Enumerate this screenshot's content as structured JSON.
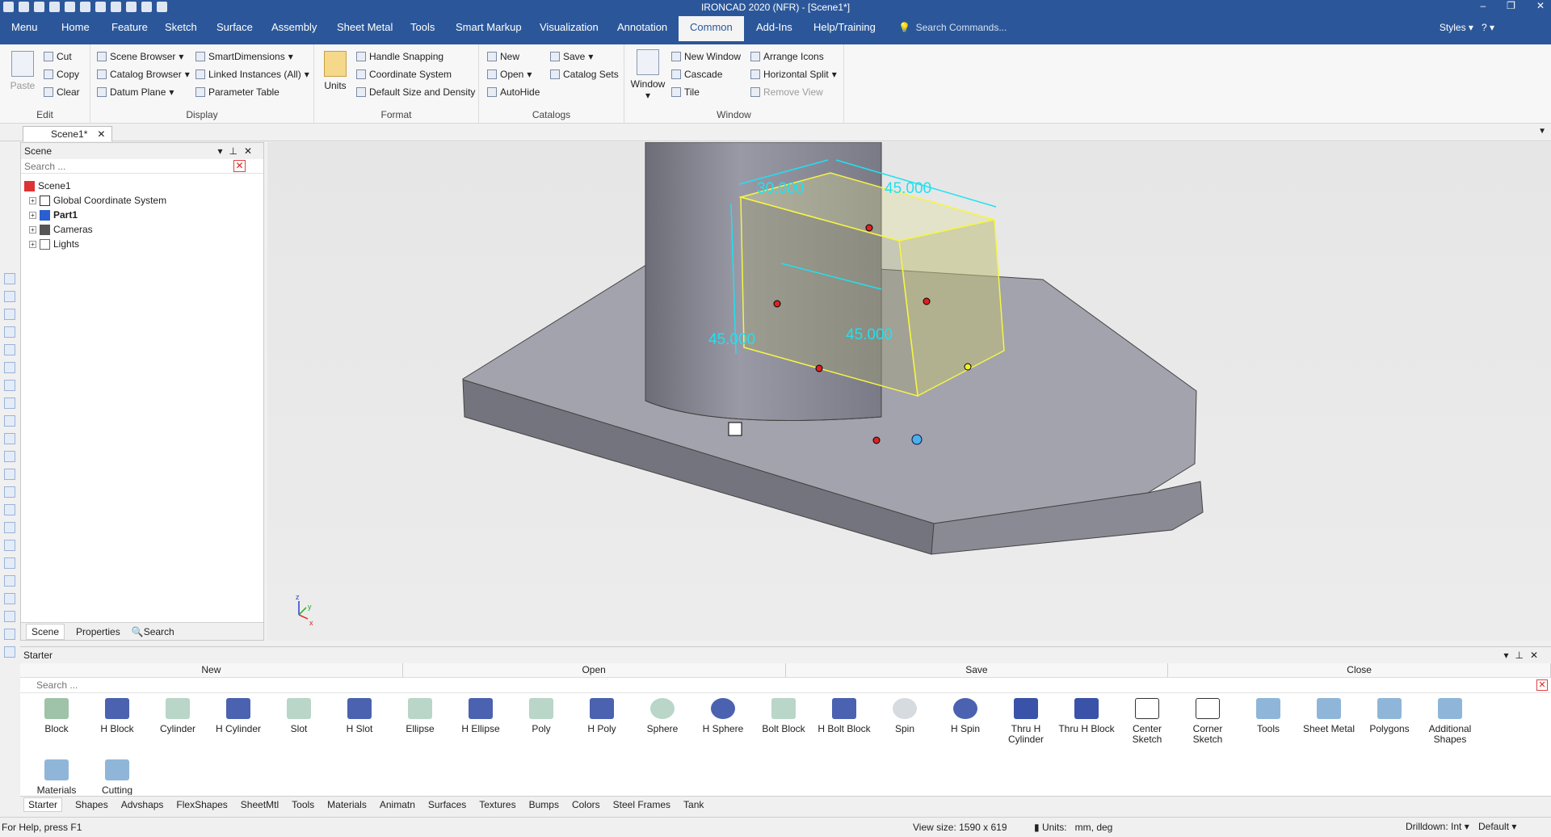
{
  "app": {
    "title": "IRONCAD 2020 (NFR) - [Scene1*]"
  },
  "menu": {
    "tabs": [
      "Menu",
      "Home",
      "Feature",
      "Sketch",
      "Surface",
      "Assembly",
      "Sheet Metal",
      "Tools",
      "Smart Markup",
      "Visualization",
      "Annotation",
      "Common",
      "Add-Ins",
      "Help/Training"
    ],
    "active": "Common",
    "search_placeholder": "Search Commands...",
    "styles": "Styles"
  },
  "ribbon": {
    "edit": {
      "label": "Edit",
      "paste": "Paste",
      "cut": "Cut",
      "copy": "Copy",
      "clear": "Clear"
    },
    "display": {
      "label": "Display",
      "scene_browser": "Scene Browser",
      "catalog_browser": "Catalog Browser",
      "datum_plane": "Datum Plane",
      "smart_dimensions": "SmartDimensions",
      "linked_instances": "Linked Instances (All)",
      "parameter_table": "Parameter Table"
    },
    "format": {
      "label": "Format",
      "units": "Units",
      "handle_snapping": "Handle Snapping",
      "coordinate_system": "Coordinate System",
      "default_size": "Default Size and Density"
    },
    "catalogs": {
      "label": "Catalogs",
      "new": "New",
      "open": "Open",
      "autohide": "AutoHide",
      "save": "Save",
      "catalog_sets": "Catalog Sets"
    },
    "window": {
      "label": "Window",
      "window": "Window",
      "new_window": "New Window",
      "cascade": "Cascade",
      "tile": "Tile",
      "arrange_icons": "Arrange Icons",
      "horizontal_split": "Horizontal Split",
      "remove_view": "Remove View"
    }
  },
  "doc_tab": "Scene1*",
  "scene_panel": {
    "title": "Scene",
    "search_placeholder": "Search ...",
    "tree": [
      "Scene1",
      "Global Coordinate System",
      "Part1",
      "Cameras",
      "Lights"
    ],
    "tabs": [
      "Scene",
      "Properties",
      "Search"
    ]
  },
  "viewport": {
    "dims": [
      "30.000",
      "45.000",
      "45.000",
      "45.000"
    ],
    "axes": [
      "z",
      "y",
      "x"
    ]
  },
  "catalog": {
    "title": "Starter",
    "actions": [
      "New",
      "Open",
      "Save",
      "Close"
    ],
    "search_placeholder": "Search ...",
    "items": [
      "Block",
      "H Block",
      "Cylinder",
      "H Cylinder",
      "Slot",
      "H Slot",
      "Ellipse",
      "H Ellipse",
      "Poly",
      "H Poly",
      "Sphere",
      "H Sphere",
      "Bolt Block",
      "H Bolt Block",
      "Spin",
      "H Spin",
      "Thru H Cylinder",
      "Thru H Block",
      "Center Sketch",
      "Corner Sketch",
      "Tools",
      "Sheet Metal",
      "Polygons",
      "Additional Shapes",
      "Materials",
      "Cutting"
    ],
    "tabs": [
      "Starter",
      "Shapes",
      "Advshaps",
      "FlexShapes",
      "SheetMtl",
      "Tools",
      "Materials",
      "Animatn",
      "Surfaces",
      "Textures",
      "Bumps",
      "Colors",
      "Steel Frames",
      "Tank"
    ]
  },
  "status": {
    "help": "For Help, press F1",
    "view_size": "View size: 1590 x  619",
    "units_label": "Units:",
    "units_value": "mm, deg",
    "drilldown": "Drilldown: Int",
    "default": "Default"
  }
}
